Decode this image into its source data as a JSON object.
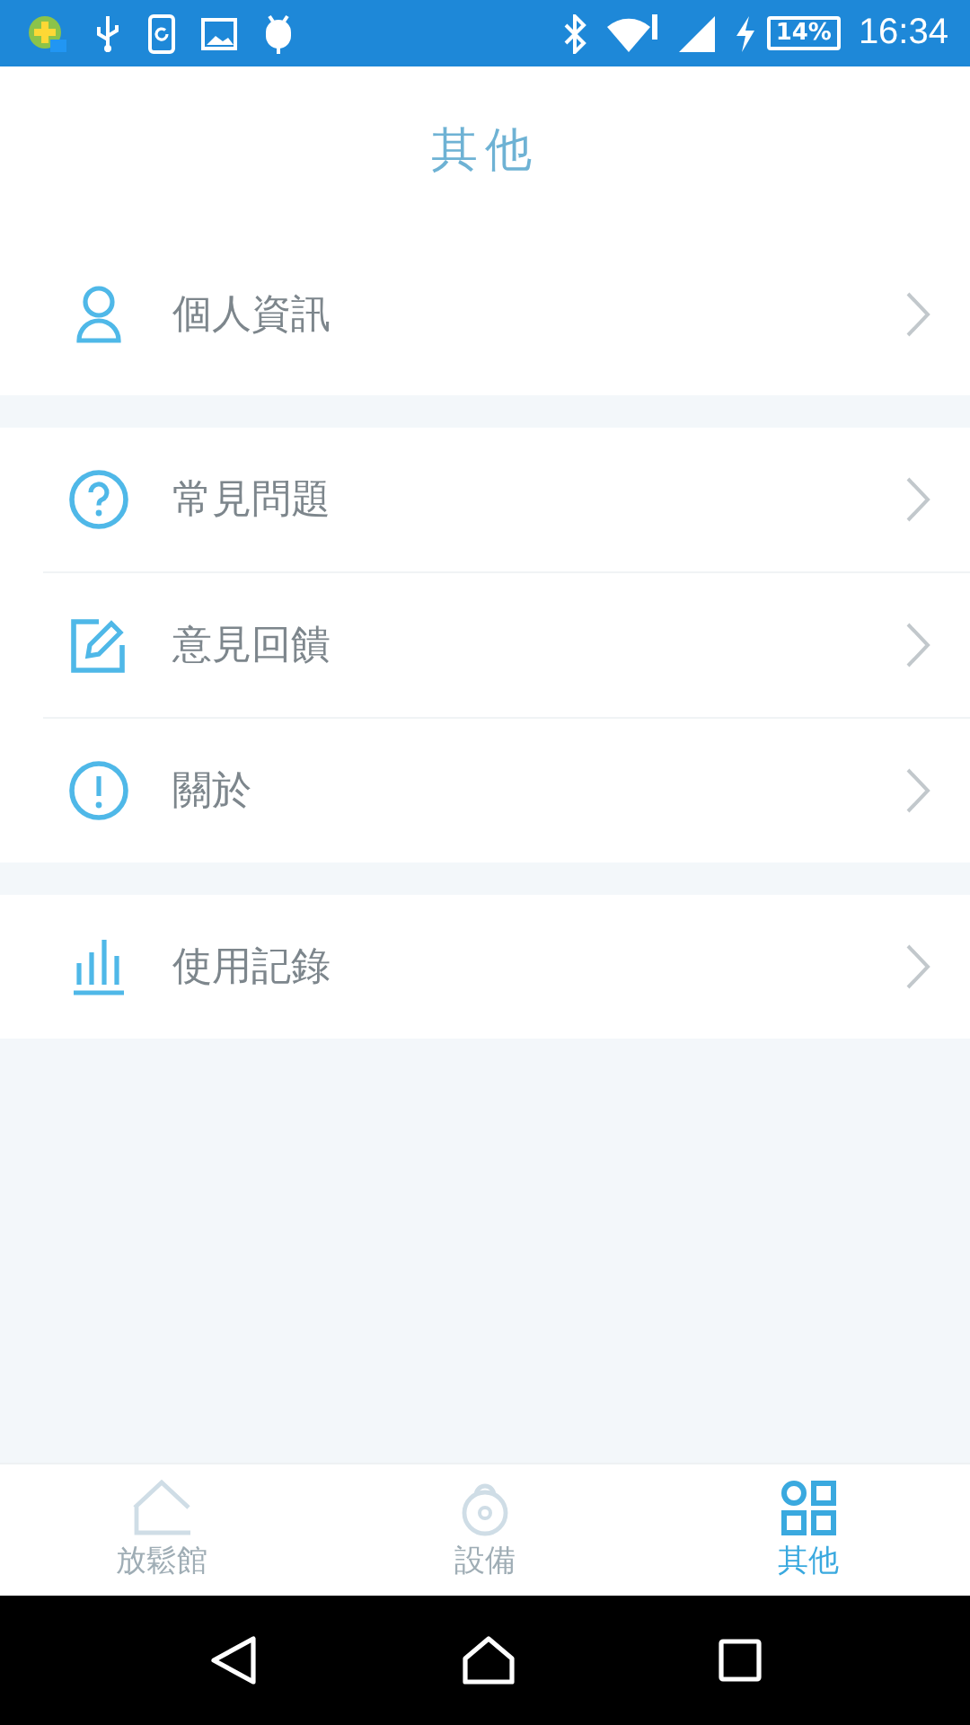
{
  "status_bar": {
    "battery": "14%",
    "time": "16:34"
  },
  "header": {
    "title": "其他"
  },
  "groups": [
    {
      "items": [
        {
          "label": "個人資訊",
          "kind": "person"
        }
      ]
    },
    {
      "items": [
        {
          "label": "常見問題",
          "kind": "question"
        },
        {
          "label": "意見回饋",
          "kind": "edit"
        },
        {
          "label": "關於",
          "kind": "info"
        }
      ]
    },
    {
      "items": [
        {
          "label": "使用記錄",
          "kind": "chart"
        }
      ]
    }
  ],
  "tabs": [
    {
      "label": "放鬆館",
      "kind": "home",
      "selected": false
    },
    {
      "label": "設備",
      "kind": "lock",
      "selected": false
    },
    {
      "label": "其他",
      "kind": "grid",
      "selected": true
    }
  ]
}
